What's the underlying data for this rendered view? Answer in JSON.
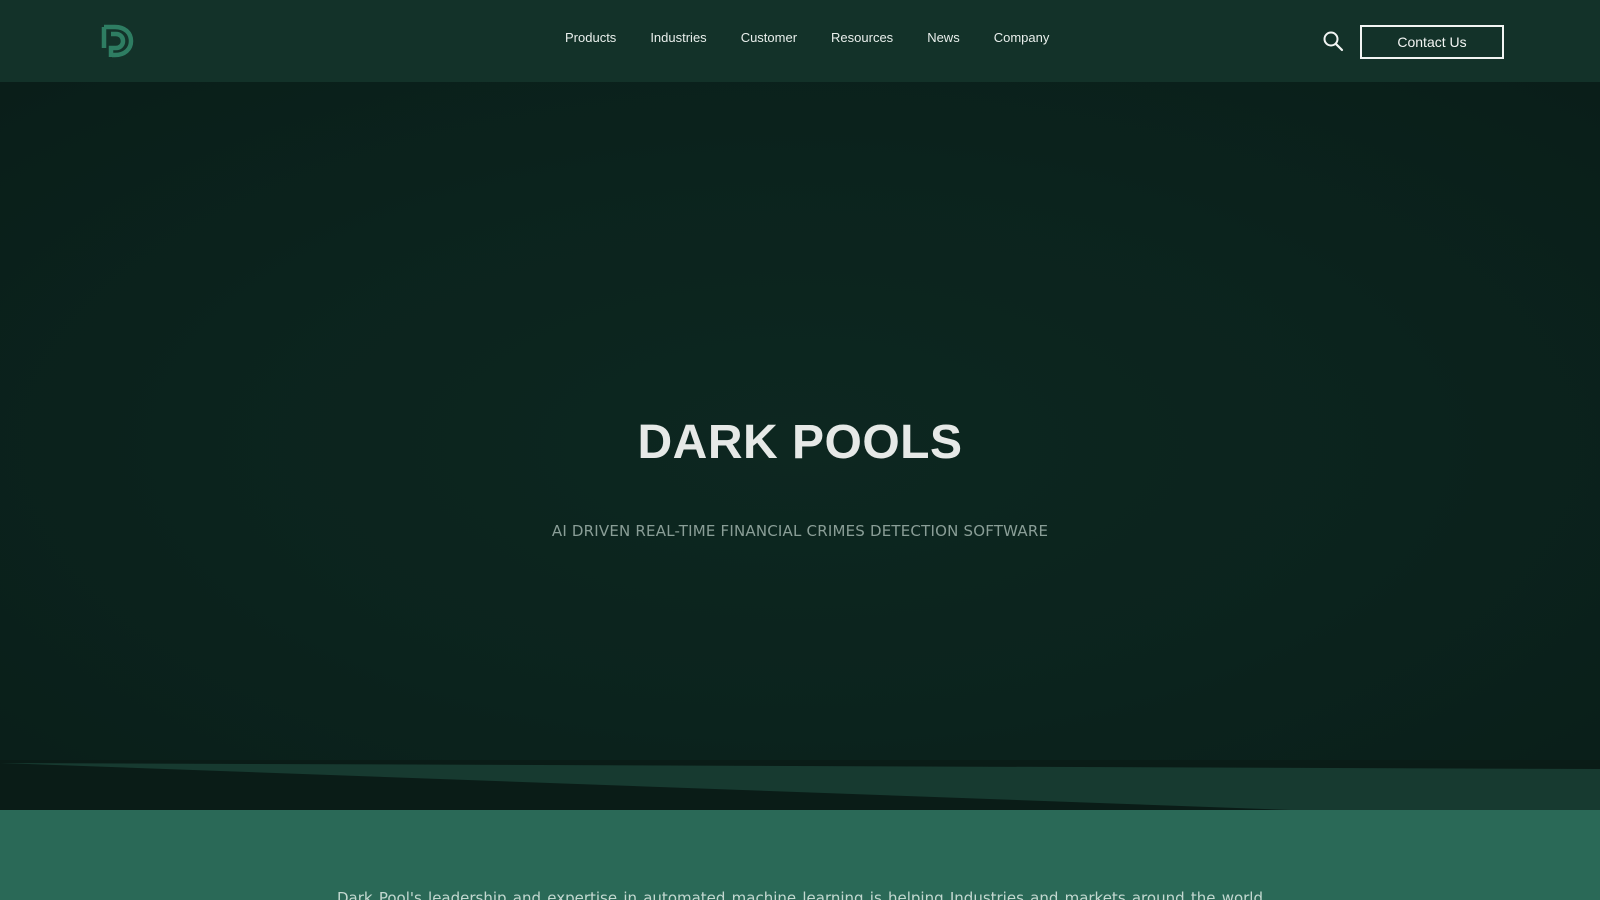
{
  "header": {
    "logo_icon": "dp-logo-icon",
    "nav": [
      {
        "label": "Products"
      },
      {
        "label": "Industries"
      },
      {
        "label": "Customer"
      },
      {
        "label": "Resources"
      },
      {
        "label": "News"
      },
      {
        "label": "Company"
      }
    ],
    "search_icon": "search-icon",
    "contact_label": "Contact Us"
  },
  "hero": {
    "title": "DARK POOLS",
    "subtitle": "AI DRIVEN REAL-TIME FINANCIAL CRIMES DETECTION SOFTWARE"
  },
  "intro": {
    "text": "Dark Pool's leadership and expertise in automated machine learning is helping Industries and markets around the world"
  },
  "colors": {
    "header_bg": "#133229",
    "hero_bg": "#0b231d",
    "accent_green": "#2a6957",
    "logo_green": "#2e7d62",
    "text_light": "#e6e9e7"
  }
}
